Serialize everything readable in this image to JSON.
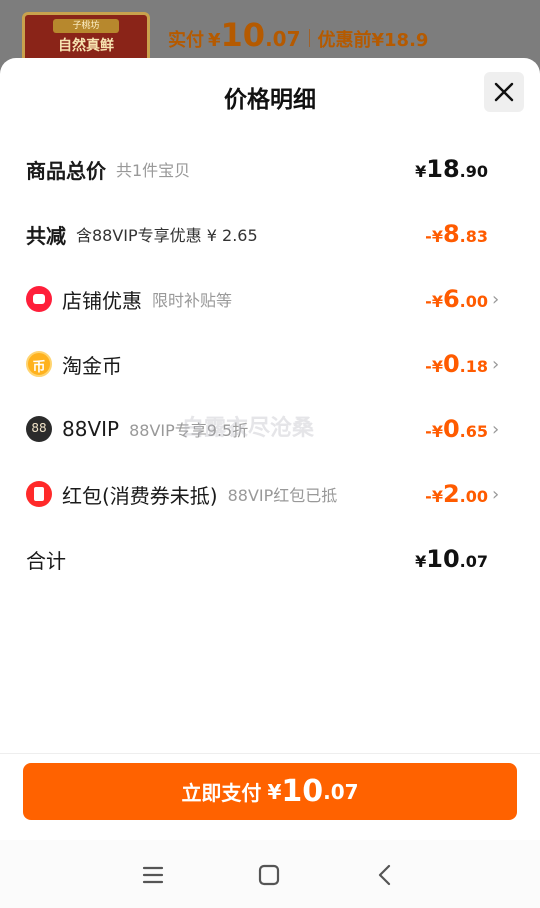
{
  "background_product": {
    "thumb_seal": "子桃坊",
    "thumb_name": "自然真鲜",
    "pay_label": "实付",
    "currency": "¥",
    "pay_int": "10",
    "pay_dec": ".07",
    "before_label": "优惠前¥18.9"
  },
  "sheet": {
    "title": "价格明细",
    "close_icon": "close-icon"
  },
  "rows": [
    {
      "label": "商品总价",
      "sub": "共1件宝贝",
      "currency": "¥",
      "int": "18",
      "dec": ".90",
      "color": "#111111"
    },
    {
      "label": "共减",
      "sub": "含88VIP专享优惠 ¥ 2.65",
      "prefix": "-¥",
      "int": "8",
      "dec": ".83",
      "color": "#ff5b00"
    },
    {
      "label": "店铺优惠",
      "sub": "限时补贴等",
      "prefix": "-¥",
      "int": "6",
      "dec": ".00",
      "icon": "shop-icon",
      "color": "#ff5b00"
    },
    {
      "label": "淘金币",
      "sub": "",
      "prefix": "-¥",
      "int": "0",
      "dec": ".18",
      "icon": "coin-icon",
      "icon_char": "币",
      "color": "#ff5b00"
    },
    {
      "label": "88VIP",
      "sub": "88VIP专享9.5折",
      "prefix": "-¥",
      "int": "0",
      "dec": ".65",
      "icon": "88vip-icon",
      "icon_char": "88",
      "color": "#ff5b00"
    },
    {
      "label": "红包(消费券未抵)",
      "sub": "88VIP红包已抵",
      "prefix": "-¥",
      "int": "2",
      "dec": ".00",
      "icon": "red-packet-icon",
      "color": "#ff5b00"
    },
    {
      "label": "合计",
      "sub": "",
      "currency": "¥",
      "int": "10",
      "dec": ".07",
      "color": "#111111"
    }
  ],
  "watermark": "白露衣尽沧桑",
  "pay_button": {
    "label": "立即支付",
    "currency": "¥",
    "int": "10",
    "dec": ".07",
    "color": "#ff6200"
  },
  "navbar": {
    "menu_icon": "menu-icon",
    "home_icon": "home-icon",
    "back_icon": "back-icon"
  }
}
